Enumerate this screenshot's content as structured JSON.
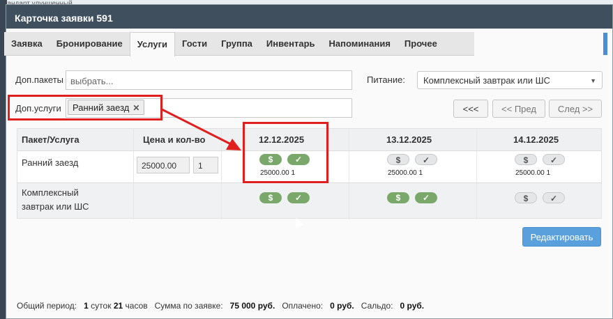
{
  "background": {
    "strip_text": "тандарт улучшенный"
  },
  "window": {
    "title": "Карточка заявки 591"
  },
  "tabs": [
    {
      "label": "Заявка",
      "active": false
    },
    {
      "label": "Бронирование",
      "active": false
    },
    {
      "label": "Услуги",
      "active": true
    },
    {
      "label": "Гости",
      "active": false
    },
    {
      "label": "Группа",
      "active": false
    },
    {
      "label": "Инвентарь",
      "active": false
    },
    {
      "label": "Напоминания",
      "active": false
    },
    {
      "label": "Прочее",
      "active": false
    }
  ],
  "form": {
    "packets_label": "Доп.пакеты",
    "packets_placeholder": "выбрать...",
    "services_label": "Доп.услуги",
    "services_chip": "Ранний заезд",
    "chip_remove": "✕",
    "meal_label": "Питание:",
    "meal_value": "Комплексный завтрак или ШС",
    "caret": "▼"
  },
  "nav": {
    "first": "<<<",
    "prev": "<< Пред",
    "next": "След >>"
  },
  "table": {
    "headers": {
      "service": "Пакет/Услуга",
      "price": "Цена и кол-во"
    },
    "dates": [
      "12.12.2025",
      "13.12.2025",
      "14.12.2025"
    ],
    "rows": [
      {
        "name": "Ранний заезд",
        "price": "25000.00",
        "qty": "1",
        "days": [
          {
            "paid": true,
            "checked": true,
            "summary": "25000.00 1"
          },
          {
            "paid": false,
            "checked": false,
            "summary": "25000.00 1"
          },
          {
            "paid": false,
            "checked": false,
            "summary": "25000.00 1"
          }
        ]
      },
      {
        "name_line1": "Комплексный",
        "name_line2": "завтрак или ШС",
        "days": [
          {
            "paid": true,
            "checked": true
          },
          {
            "paid": true,
            "checked": true
          },
          {
            "paid": false,
            "checked": false
          }
        ]
      }
    ],
    "toggle_dollar": "$",
    "toggle_check": "✓"
  },
  "edit_button": "Редактировать",
  "footer": {
    "period_label": "Общий период:",
    "days_value": "1",
    "days_unit": "суток",
    "hours_value": "21",
    "hours_unit": "часов",
    "sum_label": "Сумма по заявке:",
    "sum_value": "75 000 руб.",
    "paid_label": "Оплачено:",
    "paid_value": "0 руб.",
    "balance_label": "Сальдо:",
    "balance_value": "0 руб."
  },
  "colors": {
    "accent": "#5aa0dd",
    "toggle_on": "#7aa86b",
    "highlight": "#e01e1e",
    "titlebar": "#3f4f5e"
  }
}
